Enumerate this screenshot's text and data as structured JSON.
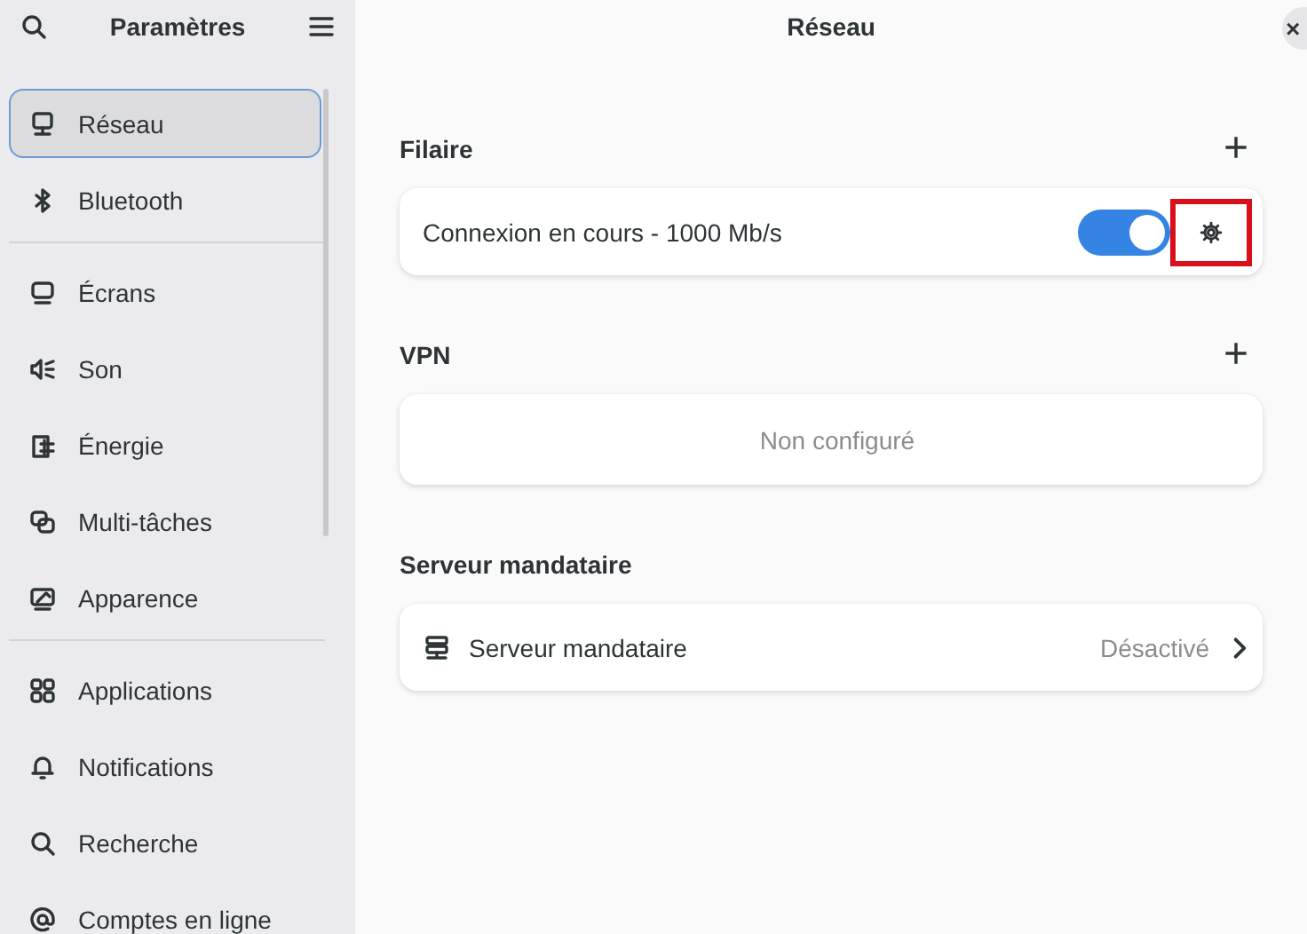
{
  "sidebar": {
    "title": "Paramètres",
    "groups": [
      [
        {
          "label": "Réseau",
          "selected": true
        },
        {
          "label": "Bluetooth",
          "selected": false
        }
      ],
      [
        {
          "label": "Écrans",
          "selected": false
        },
        {
          "label": "Son",
          "selected": false
        },
        {
          "label": "Énergie",
          "selected": false
        },
        {
          "label": "Multi-tâches",
          "selected": false
        },
        {
          "label": "Apparence",
          "selected": false
        }
      ],
      [
        {
          "label": "Applications",
          "selected": false
        },
        {
          "label": "Notifications",
          "selected": false
        },
        {
          "label": "Recherche",
          "selected": false
        },
        {
          "label": "Comptes en ligne",
          "selected": false
        }
      ]
    ]
  },
  "page": {
    "title": "Réseau",
    "close": "×"
  },
  "sections": [
    {
      "title": "Filaire",
      "add": "+",
      "rows": [
        {
          "kind": "connection",
          "label": "Connexion en cours - 1000 Mb/s",
          "on": true,
          "highlighted": true
        }
      ]
    },
    {
      "title": "VPN",
      "add": "+",
      "rows": [
        {
          "kind": "empty",
          "label": "Non configuré"
        }
      ]
    },
    {
      "title": "Serveur mandataire",
      "rows": [
        {
          "kind": "link",
          "label": "Serveur mandataire",
          "value": "Désactivé"
        }
      ]
    }
  ]
}
